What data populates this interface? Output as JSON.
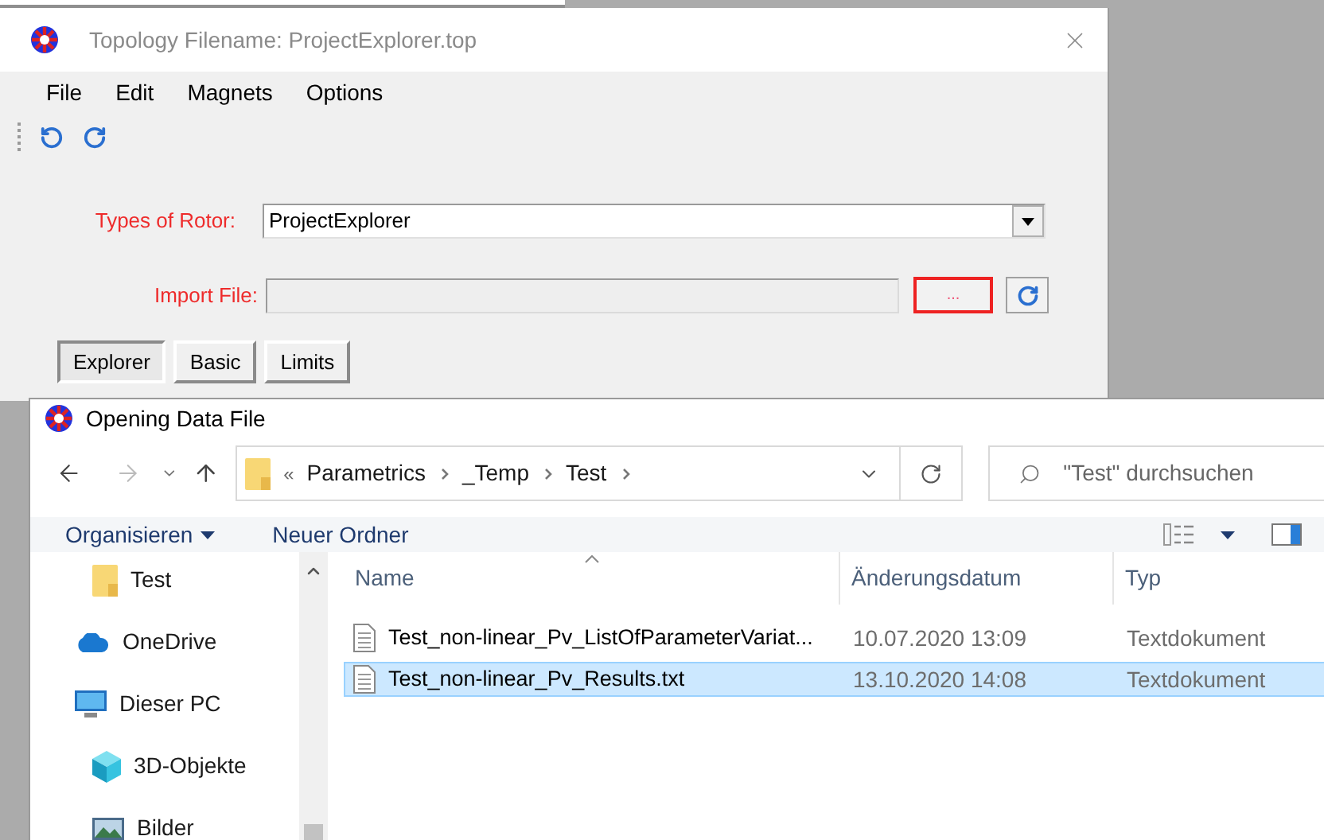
{
  "main_window": {
    "title": "Topology Filename: ProjectExplorer.top",
    "menu": [
      "File",
      "Edit",
      "Magnets",
      "Options"
    ],
    "fields": [
      {
        "kind": "combobox",
        "label": "Types of Rotor:",
        "value": "ProjectExplorer"
      },
      {
        "kind": "file",
        "label": "Import File:",
        "browse": "...",
        "focused": true
      }
    ],
    "tabs": [
      {
        "label": "Explorer",
        "selected": true
      },
      {
        "label": "Basic",
        "selected": false
      },
      {
        "label": "Limits",
        "selected": false
      }
    ]
  },
  "dialog": {
    "title": "Opening Data File",
    "overflow": "«",
    "breadcrumb": [
      "Parametrics",
      "_Temp",
      "Test"
    ],
    "search": {
      "placeholder": "\"Test\" durchsuchen"
    },
    "commands": [
      {
        "label": "Organisieren",
        "dropdown": true
      },
      {
        "label": "Neuer Ordner",
        "dropdown": false
      }
    ],
    "nav_tree": [
      {
        "children": [
          {
            "label": "Test",
            "kind": "folder"
          }
        ]
      },
      {
        "label": "OneDrive",
        "kind": "cloud"
      },
      {
        "label": "Dieser PC",
        "kind": "pc",
        "children": [
          {
            "label": "3D-Objekte",
            "kind": "cube"
          },
          {
            "label": "Bilder",
            "kind": "pictures"
          }
        ]
      }
    ],
    "columns": [
      {
        "label": "Name",
        "sorted": true
      },
      {
        "label": "Änderungsdatum",
        "sorted": false
      },
      {
        "label": "Typ",
        "sorted": false
      }
    ],
    "files": [
      {
        "name": "Test_non-linear_Pv_ListOfParameterVariat...",
        "date": "10.07.2020 13:09",
        "type": "Textdokument",
        "selected": false
      },
      {
        "name": "Test_non-linear_Pv_Results.txt",
        "date": "13.10.2020 14:08",
        "type": "Textdokument",
        "selected": true
      }
    ]
  }
}
